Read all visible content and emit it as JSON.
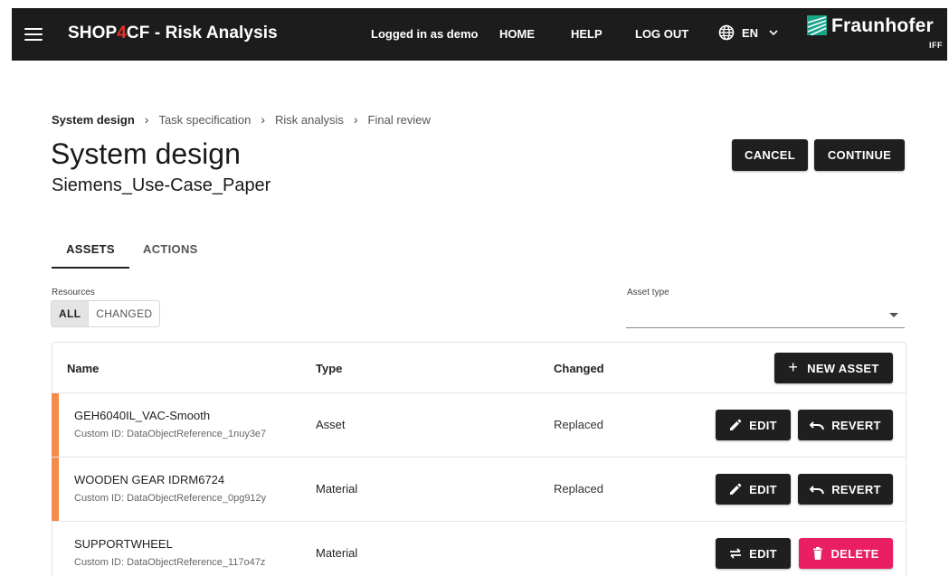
{
  "header": {
    "app_title_prefix": "SHOP",
    "app_title_accent": "4",
    "app_title_suffix": "CF - Risk Analysis",
    "user_status": "Logged in as demo",
    "nav": {
      "home": "HOME",
      "help": "HELP",
      "logout": "LOG OUT"
    },
    "language": "EN",
    "logo": {
      "name": "Fraunhofer",
      "sub": "IFF"
    },
    "accent_color": "#e5322d"
  },
  "breadcrumb": [
    "System design",
    "Task specification",
    "Risk analysis",
    "Final review"
  ],
  "page": {
    "title": "System design",
    "subtitle": "Siemens_Use-Case_Paper",
    "cancel_label": "CANCEL",
    "continue_label": "CONTINUE"
  },
  "tabs": {
    "assets": "ASSETS",
    "actions": "ACTIONS",
    "active": "ASSETS"
  },
  "filters": {
    "resources_label": "Resources",
    "resources_options": [
      "ALL",
      "CHANGED"
    ],
    "resources_selected": "ALL",
    "asset_type_label": "Asset type",
    "asset_type_value": ""
  },
  "table": {
    "columns": {
      "name": "Name",
      "type": "Type",
      "changed": "Changed"
    },
    "new_asset_label": "NEW ASSET",
    "rows": [
      {
        "name": "GEH6040IL_VAC-Smooth",
        "custom_id": "Custom ID: DataObjectReference_1nuy3e7",
        "type": "Asset",
        "changed": "Replaced",
        "edit_label": "EDIT",
        "secondary_label": "REVERT",
        "secondary_kind": "revert",
        "marker": true
      },
      {
        "name": "WOODEN GEAR IDRM6724",
        "custom_id": "Custom ID: DataObjectReference_0pg912y",
        "type": "Material",
        "changed": "Replaced",
        "edit_label": "EDIT",
        "secondary_label": "REVERT",
        "secondary_kind": "revert",
        "marker": true
      },
      {
        "name": "SUPPORTWHEEL",
        "custom_id": "Custom ID: DataObjectReference_117o47z",
        "type": "Material",
        "changed": "",
        "edit_label": "EDIT",
        "secondary_label": "DELETE",
        "secondary_kind": "delete",
        "marker": false
      }
    ],
    "marker_color": "#f58a4b",
    "delete_color": "#e91e63"
  }
}
